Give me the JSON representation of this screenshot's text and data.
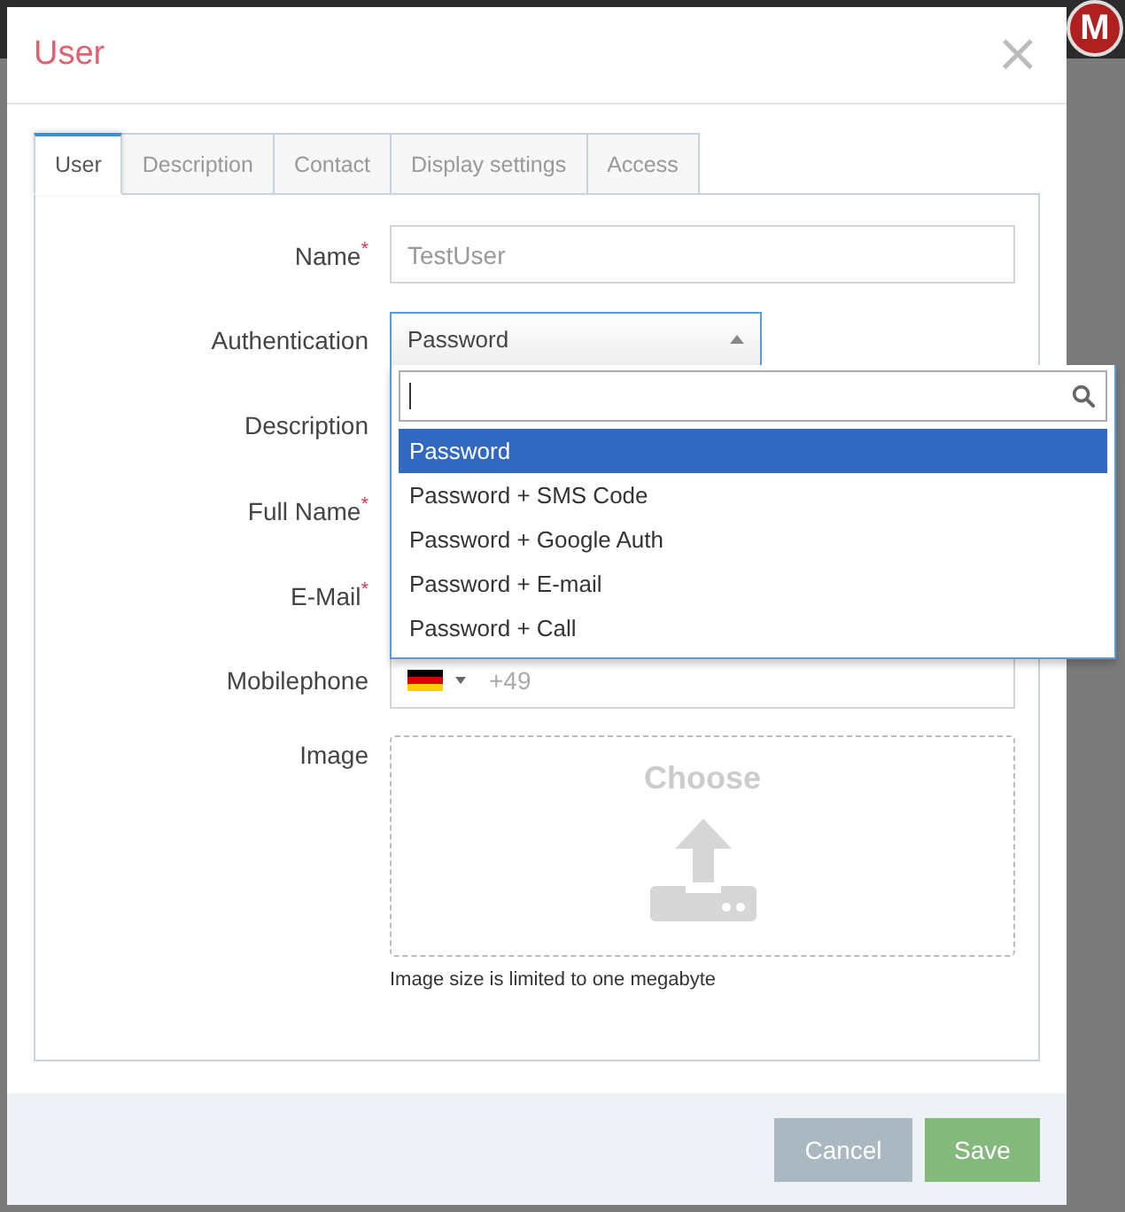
{
  "background": {
    "avatar": "M"
  },
  "dialog": {
    "title": "User",
    "close": "×"
  },
  "tabs": [
    {
      "label": "User",
      "selected": true
    },
    {
      "label": "Description",
      "selected": false
    },
    {
      "label": "Contact",
      "selected": false
    },
    {
      "label": "Display settings",
      "selected": false
    },
    {
      "label": "Access",
      "selected": false
    }
  ],
  "fields": [
    {
      "kind": "text",
      "label": "Name$^{*}$",
      "value": "TestUser"
    },
    {
      "kind": "select",
      "label": "Authentication",
      "value": "Password",
      "expanded": true
    },
    {
      "kind": "covered",
      "label": "Description"
    },
    {
      "kind": "covered",
      "label": "Full Name$^{*}$"
    },
    {
      "kind": "covered",
      "label": "E-Mail$^{*}$"
    },
    {
      "kind": "phone",
      "label": "Mobilephone",
      "placeholder": "+49"
    },
    {
      "kind": "image",
      "label": "Image",
      "button": "Choose",
      "note": "Image size is limited to one megabyte"
    }
  ],
  "dropdown": {
    "options": [
      {
        "label": "Password",
        "selected": true
      },
      {
        "label": "Password + SMS Code",
        "selected": false
      },
      {
        "label": "Password + Google Auth",
        "selected": false
      },
      {
        "label": "Password + E-mail",
        "selected": false
      },
      {
        "label": "Password + Call",
        "selected": false
      }
    ]
  },
  "buttons": [
    {
      "kind": "cancel",
      "label": "Cancel"
    },
    {
      "kind": "save",
      "label": "Save"
    }
  ]
}
